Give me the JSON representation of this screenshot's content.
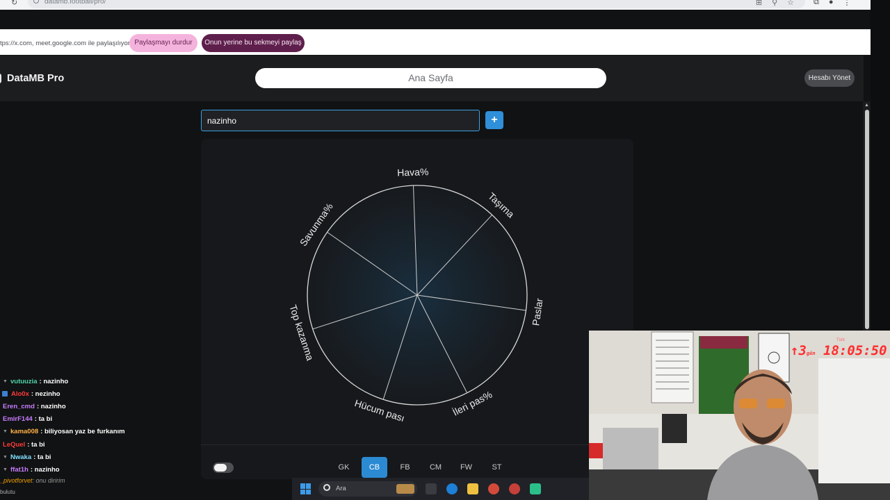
{
  "browser": {
    "url": "datamb.football/pro/"
  },
  "share_bar": {
    "text": "tps://x.com, meet.google.com ile paylaşılıyor",
    "stop_label": "Paylaşmayı durdur",
    "share_label": "Onun yerine bu sekmeyi paylaş"
  },
  "header": {
    "brand": "DataMB Pro",
    "home_label": "Ana Sayfa",
    "account_label": "Hesabı Yönet"
  },
  "search": {
    "value": "nazinho"
  },
  "add_button": {
    "label": "+"
  },
  "chart_data": {
    "type": "radar",
    "axes": [
      "Hava%",
      "Taşıma",
      "Paslar",
      "İleri pas%",
      "Hücum pası",
      "Top kazanma",
      "Savunma%"
    ],
    "values": []
  },
  "positions": {
    "tabs": [
      "GK",
      "CB",
      "FB",
      "CM",
      "FW",
      "ST"
    ],
    "active": "CB"
  },
  "chat": {
    "lines": [
      {
        "badge": "▼",
        "user": "vutuuzia",
        "color": "#4fd6a8",
        "message": ": nazinho"
      },
      {
        "badge": "sq",
        "user": "Alo0x",
        "color": "#ff3b3b",
        "message": ": nezinho"
      },
      {
        "badge": "",
        "user": "Eren_cmd",
        "color": "#c77dff",
        "message": ": nazinho"
      },
      {
        "badge": "",
        "user": "EmirF144",
        "color": "#c77dff",
        "message": ": ta bi"
      },
      {
        "badge": "▼",
        "user": "kama008",
        "color": "#ffb347",
        "message": ": biliyosan yaz be furkanım"
      },
      {
        "badge": "",
        "user": "LeQuel",
        "color": "#ff3b3b",
        "message": ": ta bi"
      },
      {
        "badge": "▼",
        "user": "Nwaka",
        "color": "#7fe0ff",
        "message": ": ta bi"
      },
      {
        "badge": "▼",
        "user": "ffat1h",
        "color": "#c77dff",
        "message": ": nazinho"
      }
    ],
    "bottom_user": "_pivotforvet",
    "bottom_message": ": onu diririm",
    "tiny": "bulutu"
  },
  "taskbar": {
    "search_placeholder": "Ara"
  },
  "webcam": {
    "timer_top": "Türk",
    "timer_days": "3",
    "timer_day_label": "gün",
    "timer_time": "18:05:50"
  },
  "colors": {
    "accent": "#2c8ad3",
    "share_stop": "#f4b3dc",
    "share_other": "#5e1f4c",
    "timer": "#ff2c2c"
  }
}
